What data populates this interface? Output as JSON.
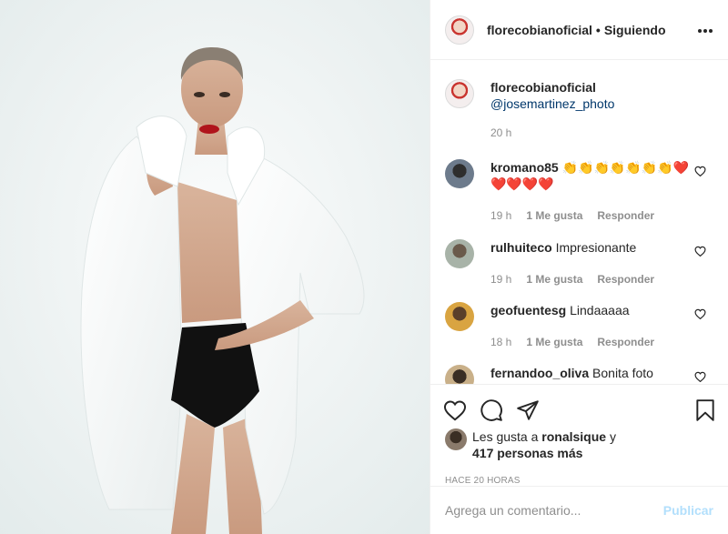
{
  "post": {
    "username": "florecobianoficial",
    "separator": "•",
    "follow_status": "Siguiendo",
    "more_icon": "more-horizontal-icon"
  },
  "caption": {
    "username": "florecobianoficial",
    "mention": "@josemartinez_photo",
    "time": "20 h"
  },
  "comments": [
    {
      "username": "kromano85",
      "text": "👏👏👏👏👏👏👏❤️❤️❤️❤️❤️",
      "time": "19 h",
      "likes": "1 Me gusta",
      "reply": "Responder"
    },
    {
      "username": "rulhuiteco",
      "text": "Impresionante",
      "time": "19 h",
      "likes": "1 Me gusta",
      "reply": "Responder"
    },
    {
      "username": "geofuentesg",
      "text": "Lindaaaaa",
      "time": "18 h",
      "likes": "1 Me gusta",
      "reply": "Responder"
    },
    {
      "username": "fernandoo_oliva",
      "text": "Bonita foto",
      "time": "",
      "likes": "",
      "reply": ""
    }
  ],
  "actions": {
    "icons": [
      "heart-icon",
      "comment-icon",
      "share-icon",
      "bookmark-icon"
    ]
  },
  "likes": {
    "prefix": "Les gusta a",
    "user": "ronalsique",
    "conjunction": "y",
    "others": "417 personas más"
  },
  "timestamp": "HACE 20 HORAS",
  "add_comment": {
    "placeholder": "Agrega un comentario...",
    "publish_label": "Publicar"
  },
  "colors": {
    "text": "#262626",
    "muted": "#8e8e8e",
    "link": "#00376b",
    "publish_disabled": "#b2dffc",
    "border": "#efefef"
  }
}
